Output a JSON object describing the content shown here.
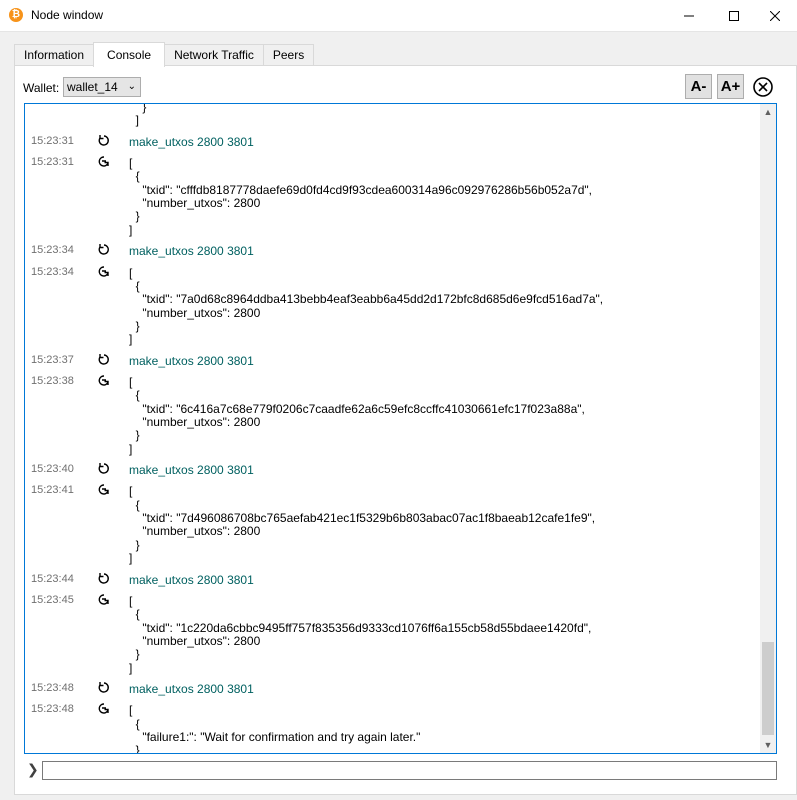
{
  "window": {
    "title": "Node window",
    "app_icon_glyph": "₿",
    "icons": {
      "app": "bitcoin-icon",
      "minimize": "minimize-icon",
      "maximize": "maximize-icon",
      "close": "close-icon"
    }
  },
  "tabs": [
    {
      "label": "Information",
      "active": false
    },
    {
      "label": "Console",
      "active": true
    },
    {
      "label": "Network Traffic",
      "active": false
    },
    {
      "label": "Peers",
      "active": false
    }
  ],
  "wallet": {
    "label": "Wallet:",
    "selected": "wallet_14"
  },
  "toolbar": {
    "font_smaller": "A-",
    "font_larger": "A+",
    "clear_icon": "clear-console-icon"
  },
  "console": {
    "top_fragment": [
      "    }",
      "  ]"
    ],
    "entries": [
      {
        "cmd_time": "15:23:31",
        "command": "make_utxos 2800 3801",
        "reply_time": "15:23:31",
        "reply": [
          "[",
          "  {",
          "    \"txid\": \"cfffdb8187778daefe69d0fd4cd9f93cdea600314a96c092976286b56b052a7d\",",
          "    \"number_utxos\": 2800",
          "  }",
          "]"
        ]
      },
      {
        "cmd_time": "15:23:34",
        "command": "make_utxos 2800 3801",
        "reply_time": "15:23:34",
        "reply": [
          "[",
          "  {",
          "    \"txid\": \"7a0d68c8964ddba413bebb4eaf3eabb6a45dd2d172bfc8d685d6e9fcd516ad7a\",",
          "    \"number_utxos\": 2800",
          "  }",
          "]"
        ]
      },
      {
        "cmd_time": "15:23:37",
        "command": "make_utxos 2800 3801",
        "reply_time": "15:23:38",
        "reply": [
          "[",
          "  {",
          "    \"txid\": \"6c416a7c68e779f0206c7caadfe62a6c59efc8ccffc41030661efc17f023a88a\",",
          "    \"number_utxos\": 2800",
          "  }",
          "]"
        ]
      },
      {
        "cmd_time": "15:23:40",
        "command": "make_utxos 2800 3801",
        "reply_time": "15:23:41",
        "reply": [
          "[",
          "  {",
          "    \"txid\": \"7d496086708bc765aefab421ec1f5329b6b803abac07ac1f8baeab12cafe1fe9\",",
          "    \"number_utxos\": 2800",
          "  }",
          "]"
        ]
      },
      {
        "cmd_time": "15:23:44",
        "command": "make_utxos 2800 3801",
        "reply_time": "15:23:45",
        "reply": [
          "[",
          "  {",
          "    \"txid\": \"1c220da6cbbc9495ff757f835356d9333cd1076ff6a155cb58d55bdaee1420fd\",",
          "    \"number_utxos\": 2800",
          "  }",
          "]"
        ]
      },
      {
        "cmd_time": "15:23:48",
        "command": "make_utxos 2800 3801",
        "reply_time": "15:23:48",
        "reply": [
          "[",
          "  {",
          "    \"failure1:\": \"Wait for confirmation and try again later.\"",
          "  }",
          "]"
        ]
      }
    ],
    "input_value": "",
    "prompt_glyph": "❯"
  }
}
